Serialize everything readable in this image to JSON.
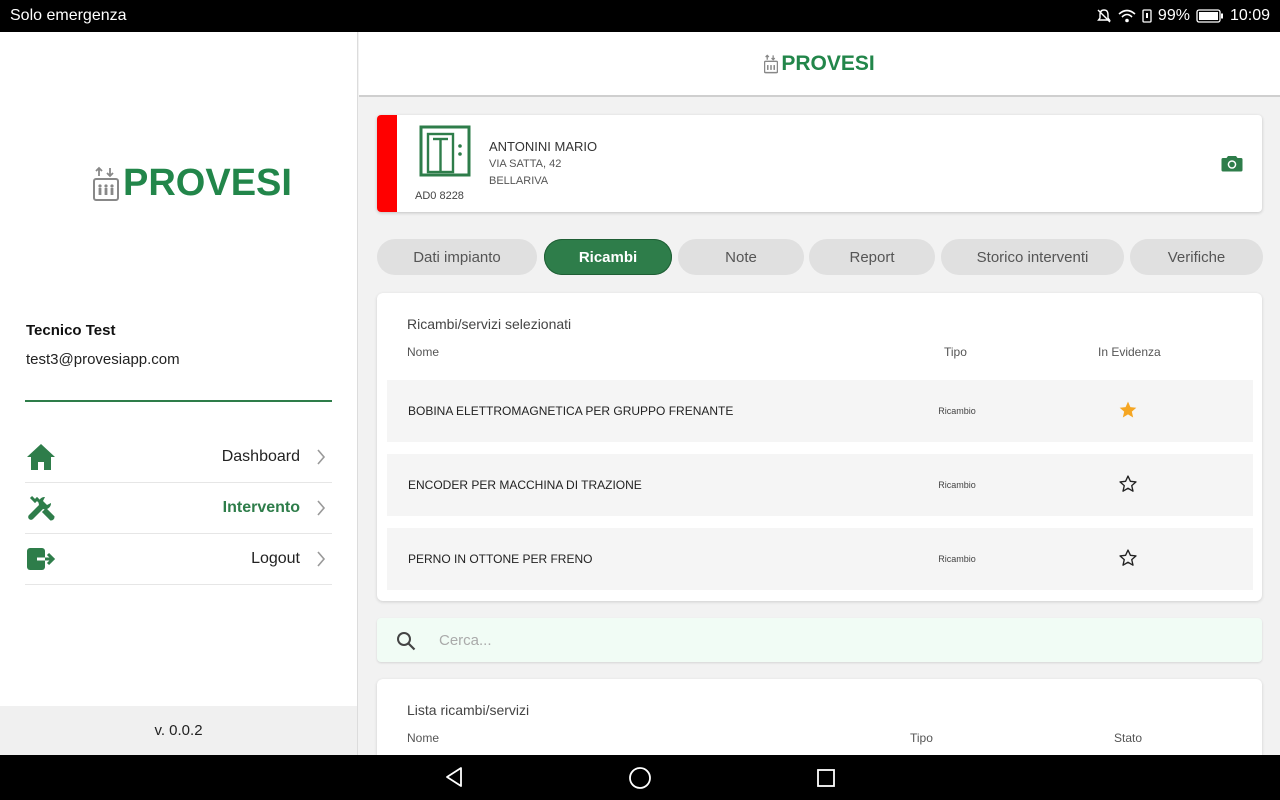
{
  "status_bar": {
    "carrier": "Solo emergenza",
    "battery": "99%",
    "time": "10:09"
  },
  "brand": {
    "name": "PROVESI",
    "color": "#22864a"
  },
  "sidebar": {
    "user_name": "Tecnico Test",
    "user_email": "test3@provesiapp.com",
    "menu": [
      {
        "label": "Dashboard",
        "icon": "home-icon",
        "active": false
      },
      {
        "label": "Intervento",
        "icon": "tools-icon",
        "active": true
      },
      {
        "label": "Logout",
        "icon": "logout-icon",
        "active": false
      }
    ],
    "version": "v. 0.0.2"
  },
  "site": {
    "client": "ANTONINI MARIO",
    "address": "VIA SATTA, 42",
    "city": "BELLARIVA",
    "code": "AD0 8228",
    "status_color": "#ff0000"
  },
  "tabs": [
    {
      "label": "Dati impianto",
      "active": false
    },
    {
      "label": "Ricambi",
      "active": true
    },
    {
      "label": "Note",
      "active": false
    },
    {
      "label": "Report",
      "active": false
    },
    {
      "label": "Storico interventi",
      "active": false
    },
    {
      "label": "Verifiche",
      "active": false
    }
  ],
  "selected": {
    "title": "Ricambi/servizi selezionati",
    "columns": {
      "name": "Nome",
      "type": "Tipo",
      "highlight": "In Evidenza"
    },
    "rows": [
      {
        "name": "BOBINA ELETTROMAGNETICA PER GRUPPO FRENANTE",
        "type": "Ricambio",
        "highlighted": true
      },
      {
        "name": "ENCODER PER MACCHINA DI TRAZIONE",
        "type": "Ricambio",
        "highlighted": false
      },
      {
        "name": "PERNO IN OTTONE PER FRENO",
        "type": "Ricambio",
        "highlighted": false
      }
    ]
  },
  "search": {
    "placeholder": "Cerca...",
    "value": ""
  },
  "list": {
    "title": "Lista ricambi/servizi",
    "columns": {
      "name": "Nome",
      "type": "Tipo",
      "status": "Stato"
    }
  },
  "colors": {
    "accent": "#2e7d4a",
    "star_filled": "#f5a623"
  }
}
